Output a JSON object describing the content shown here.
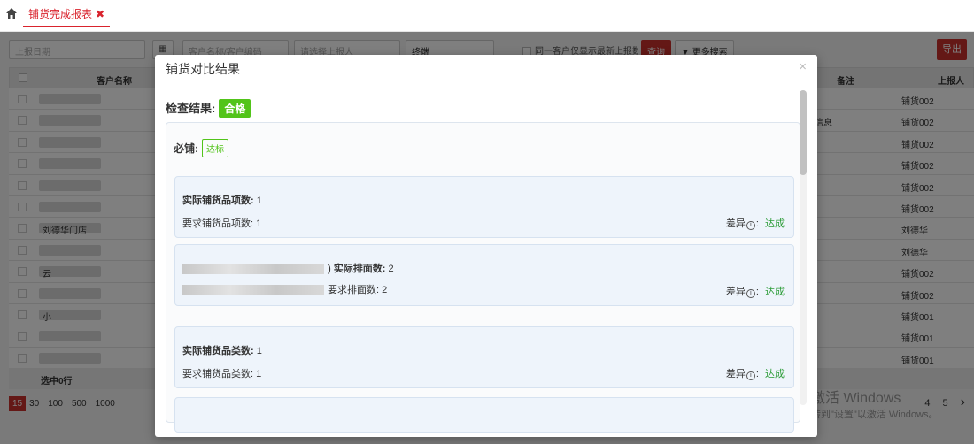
{
  "tab": {
    "label": "铺货完成报表",
    "close": "✖"
  },
  "filters": {
    "date_placeholder": "上报日期",
    "customer_placeholder": "客户名称/客户编码",
    "reporter_placeholder": "请选择上报人",
    "status_value": "终端",
    "latest_only_label": "同一客户仅显示最新上报数据",
    "search_label": "查询",
    "more_search_label": "更多搜索",
    "export_label": "导出"
  },
  "grid": {
    "columns": {
      "customer_name": "客户名称",
      "note": "备注",
      "reporter": "上报人"
    },
    "rows": [
      {
        "reporter": "铺货002",
        "note": "",
        "name": ""
      },
      {
        "reporter": "铺货002",
        "note": "信息",
        "name": ""
      },
      {
        "reporter": "铺货002",
        "note": "",
        "name": ""
      },
      {
        "reporter": "铺货002",
        "note": "",
        "name": ""
      },
      {
        "reporter": "铺货002",
        "note": "",
        "name": ""
      },
      {
        "reporter": "铺货002",
        "note": "",
        "name": ""
      },
      {
        "reporter": "刘德华",
        "note": "",
        "name": "刘德华门店"
      },
      {
        "reporter": "刘德华",
        "note": "",
        "name": ""
      },
      {
        "reporter": "铺货002",
        "note": "",
        "name": "云"
      },
      {
        "reporter": "铺货002",
        "note": "",
        "name": ""
      },
      {
        "reporter": "铺货001",
        "note": "",
        "name": "小"
      },
      {
        "reporter": "铺货001",
        "note": "",
        "name": ""
      },
      {
        "reporter": "铺货001",
        "note": "",
        "name": ""
      }
    ],
    "selected_text": "选中0行"
  },
  "pager": {
    "sizes": [
      "15",
      "30",
      "100",
      "500",
      "1000"
    ],
    "pages": [
      "4",
      "5"
    ],
    "next": "›"
  },
  "watermark": {
    "line1": "激活 Windows",
    "line2": "转到\"设置\"以激活 Windows。"
  },
  "modal": {
    "title": "铺货对比结果",
    "close": "×",
    "result_label": "检查结果:",
    "result_value": "合格",
    "required_label": "必铺:",
    "required_value": "达标",
    "cards": [
      {
        "actual_label": "实际铺货品项数:",
        "actual_value": "1",
        "required_label": "要求铺货品项数:",
        "required_value": "1",
        "diff_label": "差异",
        "diff_value": "达成"
      },
      {
        "actual_label": ") 实际排面数:",
        "actual_value": "2",
        "required_label": "要求排面数:",
        "required_value": "2",
        "diff_label": "差异",
        "diff_value": "达成"
      },
      {
        "actual_label": "实际铺货品类数:",
        "actual_value": "1",
        "required_label": "要求铺货品类数:",
        "required_value": "1",
        "diff_label": "差异",
        "diff_value": "达成"
      }
    ]
  }
}
